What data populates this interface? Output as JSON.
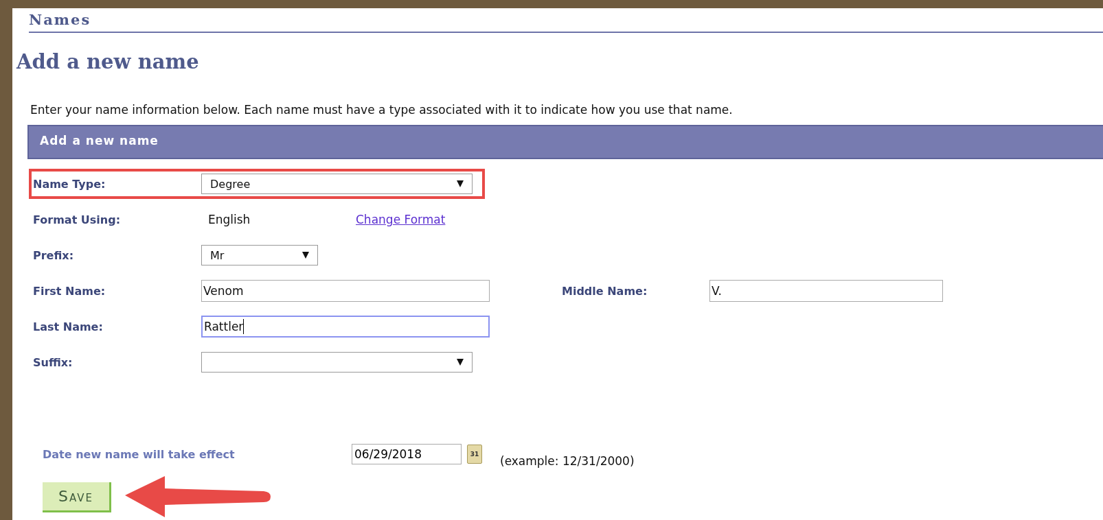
{
  "section_title": "Names",
  "heading": "Add a new name",
  "intro": "Enter your name information below. Each name must have a type associated with it to indicate how you use that name.",
  "panel_title": "Add a new name",
  "rows": [
    {
      "kind": "select",
      "label": "Name Type:",
      "value": "Degree",
      "highlighted": true
    },
    {
      "kind": "static",
      "label": "Format Using:",
      "value": "English",
      "link": "Change Format",
      "highlighted": false
    },
    {
      "kind": "short_select",
      "label": "Prefix:",
      "value": "Mr",
      "highlighted": false
    },
    {
      "kind": "text",
      "label": "First Name:",
      "value": "Venom",
      "focused": false,
      "highlighted": false,
      "side": {
        "label": "Middle Name:",
        "value": "V.",
        "focused": false
      }
    },
    {
      "kind": "text",
      "label": "Last Name:",
      "value": "Rattler",
      "focused": true,
      "highlighted": false
    },
    {
      "kind": "select",
      "label": "Suffix:",
      "value": "",
      "highlighted": false
    }
  ],
  "date": {
    "label": "Date new name will take effect",
    "value": "06/29/2018",
    "calendar_day": "31",
    "example": "(example: 12/31/2000)"
  },
  "save_button": "Save",
  "pointer_arrow": true
}
